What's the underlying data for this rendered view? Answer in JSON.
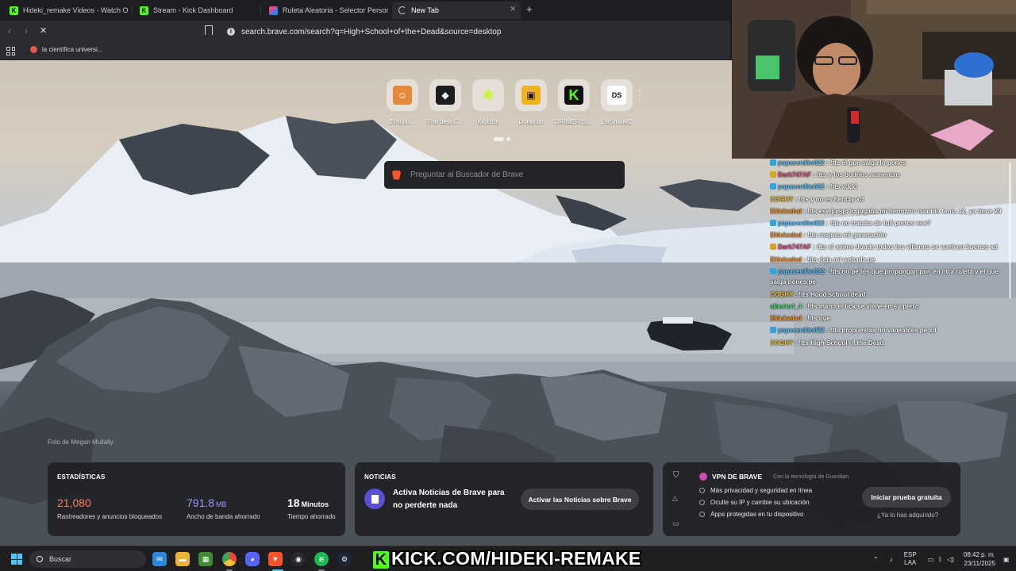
{
  "browser": {
    "tabs": [
      {
        "title": "Hideki_remake Videos - Watch O",
        "icon": "kick-icon",
        "color": "#53fc18"
      },
      {
        "title": "Stream - Kick Dashboard",
        "icon": "kick-icon",
        "color": "#53fc18"
      },
      {
        "title": "Ruleta Aleatoria - Selector Personaliz",
        "icon": "wheel-icon",
        "color": "#e24a8b"
      },
      {
        "title": "New Tab",
        "icon": "loading-icon",
        "color": "#d0d0d4"
      }
    ],
    "url": "search.brave.com/search?q=High+School+of+the+Dead&source=desktop",
    "bookmarks": [
      {
        "label": "la científica universi..."
      }
    ]
  },
  "newtab": {
    "top_sites": [
      {
        "label": "Emojip...",
        "icon": "emojipedia-icon",
        "bg": "#e5883a",
        "fg": "#fff",
        "glyph": "☺"
      },
      {
        "label": "The best C...",
        "icon": "dice-icon",
        "bg": "#1d1d1f",
        "fg": "#fff",
        "glyph": "◆"
      },
      {
        "label": "KickBot",
        "icon": "kickbot-icon",
        "bg": "transparent",
        "fg": "#c8f53a",
        "glyph": "✱"
      },
      {
        "label": "Donoclip",
        "icon": "clapperboard-icon",
        "bg": "#f1b21a",
        "fg": "#1d1d1f",
        "glyph": "▣"
      },
      {
        "label": "DRIMER St...",
        "icon": "kick-icon",
        "bg": "#0f0f10",
        "fg": "#53fc18",
        "glyph": "K"
      },
      {
        "label": "DeSmuME",
        "icon": "desmume-icon",
        "bg": "#ffffff",
        "fg": "#111",
        "glyph": "DS"
      }
    ],
    "search_placeholder": "Preguntar al Buscador de Brave",
    "photo_credit": "Foto de Megan Mullally",
    "stats": {
      "title": "ESTADÍSTICAS",
      "items": [
        {
          "value": "21,080",
          "unit": "",
          "label": "Rastreadores y anuncios bloqueados",
          "color": "#ff7b62"
        },
        {
          "value": "791.8",
          "unit": "MB",
          "label": "Ancho de banda ahorrado",
          "color": "#9f95ff"
        },
        {
          "value": "18",
          "unit": "Minutos",
          "label": "Tiempo ahorrado",
          "color": "#ffffff"
        }
      ]
    },
    "news": {
      "title": "NOTICIAS",
      "text": "Activa Noticias de Brave para no perderte nada",
      "button": "Activar las Noticias sobre Brave"
    },
    "vpn": {
      "title": "VPN DE BRAVE",
      "powered_by": "Con la tecnología de  Guardian",
      "features": [
        "Más privacidad y seguridad en línea",
        "Oculte su IP y cambie su ubicación",
        "Apps protegidas en tu dispositivo"
      ],
      "button": "Iniciar prueba gratuita",
      "link": "¿Ya lo has adquirido?"
    }
  },
  "chat": {
    "messages": [
      {
        "user": "papacerdito622",
        "text": ": !tts el que salga lo pones",
        "color": "#62c9ff",
        "badge": "#2ea5e0"
      },
      {
        "user": "Dark747AF",
        "text": ": !tts y los bodrios aumentan",
        "color": "#e0578a",
        "badge": "#d3a520"
      },
      {
        "user": "papacerdito622",
        "text": ": !tts xddd",
        "color": "#62c9ff",
        "badge": "#2ea5e0"
      },
      {
        "user": "COGHY",
        "text": ": !tts y no es hentay xd",
        "color": "#f2c94c",
        "badge": ""
      },
      {
        "user": "Eltickxdxd",
        "text": ": !tts ese juego lo jugaba mi bermano cuando tenia 12, ya tiene 29",
        "color": "#ff9b2e",
        "badge": ""
      },
      {
        "user": "papacerdito622",
        "text": ": !tts no trataba de full perros ese?",
        "color": "#62c9ff",
        "badge": "#2ea5e0"
      },
      {
        "user": "Eltickxdxd",
        "text": ": !tts respeta mi generación",
        "color": "#ff9b2e",
        "badge": ""
      },
      {
        "user": "Dark747AF",
        "text": ": !tts el anime donde todos los villanos se vuelven buenos xd",
        "color": "#e0578a",
        "badge": "#d3a520"
      },
      {
        "user": "Eltickxdxd",
        "text": ": !tts deja mi webada pe",
        "color": "#ff9b2e",
        "badge": ""
      },
      {
        "user": "papacerdito622",
        "text": ": !tts no pe los que propongan pon en otra ruleta y el que salga pones pe",
        "color": "#62c9ff",
        "badge": "#2ea5e0",
        "wrap": true
      },
      {
        "user": "COGHY",
        "text": ": !tts Hood school dead",
        "color": "#f2c94c",
        "badge": ""
      },
      {
        "user": "alberto4_4",
        "text": ": !tts mano el tick se viene en su perro",
        "color": "#5ee07c",
        "badge": ""
      },
      {
        "user": "Eltickxdxd",
        "text": ": !tts que",
        "color": "#ff9b2e",
        "badge": ""
      },
      {
        "user": "papacerdito622",
        "text": ": !tts propuestas no vaneables pe xd",
        "color": "#62c9ff",
        "badge": "#2ea5e0"
      },
      {
        "user": "COGHY",
        "text": ": !tts High School of the Dead",
        "color": "#f2c94c",
        "badge": ""
      }
    ]
  },
  "overlay": {
    "kick_url": "KICK.COM/HIDEKI-REMAKE"
  },
  "taskbar": {
    "search": "Buscar",
    "language": "ESP",
    "layout": "LAA",
    "time": "08:42 p. m.",
    "date": "23/11/2025"
  }
}
